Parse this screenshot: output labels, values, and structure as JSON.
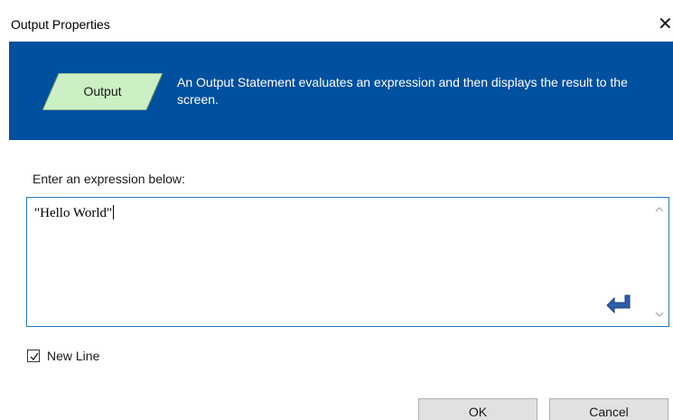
{
  "window": {
    "title": "Output Properties",
    "close_glyph": "✕"
  },
  "banner": {
    "shape_label": "Output",
    "description": "An Output Statement evaluates an expression and then displays the result to the screen.",
    "colors": {
      "banner_bg": "#0050a0",
      "shape_fill": "#ccf0c4"
    }
  },
  "expression": {
    "label": "Enter an expression below:",
    "value": "\"Hello World\"",
    "icons": [
      "chevron-up-icon",
      "chevron-down-icon",
      "enter-key-icon"
    ]
  },
  "options": {
    "new_line_label": "New Line",
    "new_line_checked": true
  },
  "buttons": {
    "ok_label": "OK",
    "cancel_label": "Cancel"
  }
}
